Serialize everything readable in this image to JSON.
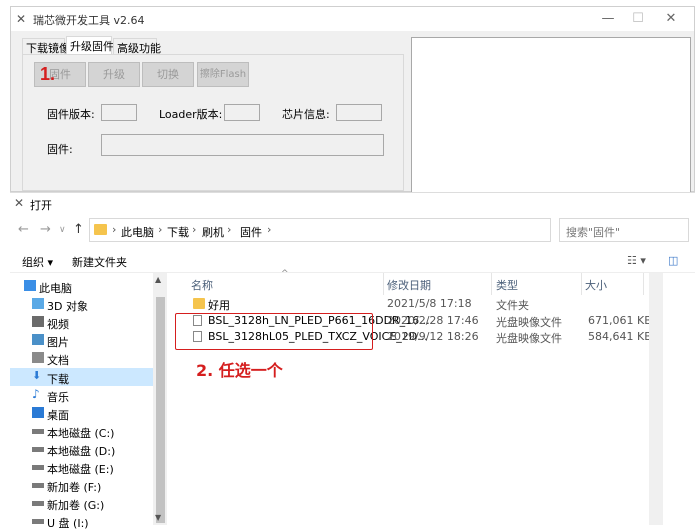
{
  "app": {
    "title": "瑞芯微开发工具 v2.64",
    "tabs": [
      "下载镜像",
      "升级固件",
      "高级功能"
    ],
    "active_tab": "升级固件",
    "buttons": [
      "固件",
      "升级",
      "切换",
      "擦除Flash"
    ],
    "labels": {
      "fw_version": "固件版本:",
      "loader_version": "Loader版本:",
      "chip_info": "芯片信息:",
      "firmware": "固件:"
    },
    "step1": "1."
  },
  "dialog": {
    "title": "打开",
    "breadcrumb": [
      "此电脑",
      "下载",
      "刷机",
      "固件"
    ],
    "search_placeholder": "搜索\"固件\"",
    "toolbar": {
      "organize": "组织 ▾",
      "new_folder": "新建文件夹"
    },
    "nav": [
      {
        "label": "此电脑",
        "icon": "computer-icon"
      },
      {
        "label": "3D 对象",
        "icon": "cube-icon"
      },
      {
        "label": "视频",
        "icon": "video-icon"
      },
      {
        "label": "图片",
        "icon": "picture-icon"
      },
      {
        "label": "文档",
        "icon": "document-icon"
      },
      {
        "label": "下载",
        "icon": "download-icon"
      },
      {
        "label": "音乐",
        "icon": "music-icon"
      },
      {
        "label": "桌面",
        "icon": "desktop-icon"
      },
      {
        "label": "本地磁盘 (C:)",
        "icon": "drive-icon"
      },
      {
        "label": "本地磁盘 (D:)",
        "icon": "drive-icon"
      },
      {
        "label": "本地磁盘 (E:)",
        "icon": "drive-icon"
      },
      {
        "label": "新加卷 (F:)",
        "icon": "drive-icon"
      },
      {
        "label": "新加卷 (G:)",
        "icon": "drive-icon"
      },
      {
        "label": "U 盘 (I:)",
        "icon": "usb-drive-icon"
      }
    ],
    "selected_nav": "下载",
    "columns": [
      "名称",
      "修改日期",
      "类型",
      "大小"
    ],
    "files": [
      {
        "name": "好用",
        "date": "2021/5/8 17:18",
        "type": "文件夹",
        "size": "",
        "icon": "folder-icon"
      },
      {
        "name": "BSL_3128h_LN_PLED_P661_16DDR_16...",
        "date": "2020/2/28 17:46",
        "type": "光盘映像文件",
        "size": "671,061 KB",
        "icon": "disc-image-icon"
      },
      {
        "name": "BSL_3128hL05_PLED_TXCZ_VOICE_2D...",
        "date": "2019/9/12 18:26",
        "type": "光盘映像文件",
        "size": "584,641 KB",
        "icon": "disc-image-icon"
      }
    ],
    "step2": "2. 任选一个"
  }
}
